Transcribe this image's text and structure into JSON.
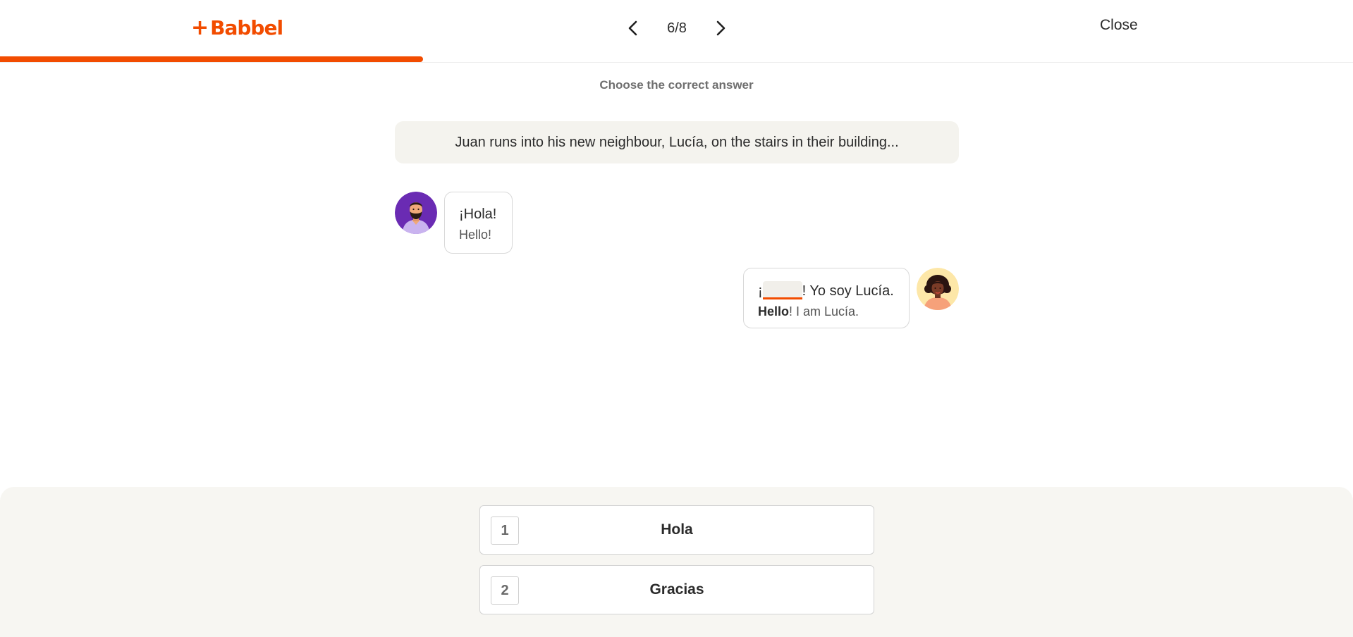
{
  "header": {
    "logo_text": "Babbel",
    "logo_plus": "+",
    "page_counter": "6/8",
    "close_label": "Close",
    "accent_color": "#f24c00",
    "progress_fraction": 0.5
  },
  "exercise": {
    "instruction": "Choose the correct answer",
    "context": "Juan runs into his new neighbour, Lucía, on the stairs in their building...",
    "messages": [
      {
        "speaker": "Juan",
        "text": "¡Hola!",
        "translation": "Hello!"
      },
      {
        "speaker": "Lucía",
        "text_prefix": "¡",
        "text_suffix": "! Yo soy Lucía.",
        "translation_bold": "Hello",
        "translation_rest": "! I am Lucía."
      }
    ]
  },
  "answers": [
    {
      "key": "1",
      "label": "Hola"
    },
    {
      "key": "2",
      "label": "Gracias"
    }
  ],
  "icons": {
    "prev": "chevron-left-icon",
    "next": "chevron-right-icon"
  }
}
